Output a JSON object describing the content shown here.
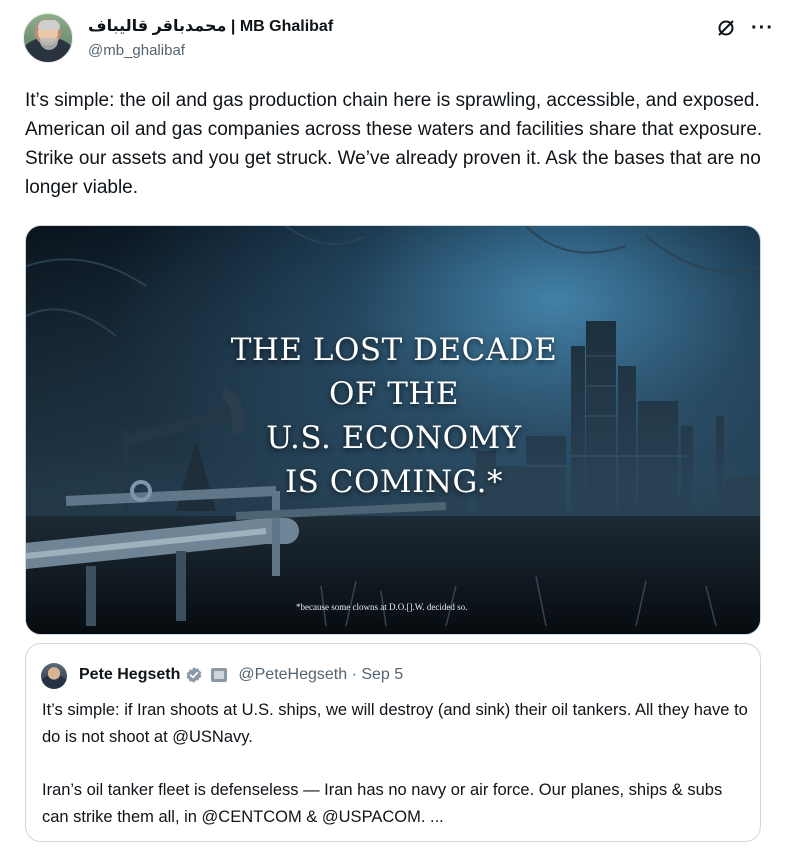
{
  "post": {
    "display_name": "محمدباقر قالیباف | MB Ghalibaf",
    "handle": "@mb_ghalibaf",
    "text": "It’s simple: the oil and gas production chain here is sprawling, accessible, and exposed. American oil and gas companies across these waters and facilities share that exposure. Strike our assets and you get struck. We’ve already proven it. Ask the bases that are no longer viable.",
    "icons": {
      "grok": "grok-icon",
      "more": "more-icon"
    },
    "more_label": "···"
  },
  "media": {
    "headline_lines": [
      "THE LOST DECADE",
      "OF THE",
      "U.S. ECONOMY",
      "IS COMING.*"
    ],
    "footnote": "*because some clowns at D.O.[].W. decided so."
  },
  "quote": {
    "name": "Pete Hegseth",
    "handle_time": "@PeteHegseth · Sep 5",
    "paragraph_1": "It’s simple: if Iran shoots at U.S. ships, we will destroy (and sink) their oil tankers. All they have to do is not shoot at @USNavy.",
    "paragraph_2": "Iran’s oil tanker fleet is defenseless — Iran has no navy or air force. Our planes, ships & subs can strike them all, in @CENTCOM & @USPACOM. ..."
  },
  "colors": {
    "text": "#0f1419",
    "secondary": "#536471",
    "verified": "#1d9bf0",
    "border": "#cfd9de"
  }
}
